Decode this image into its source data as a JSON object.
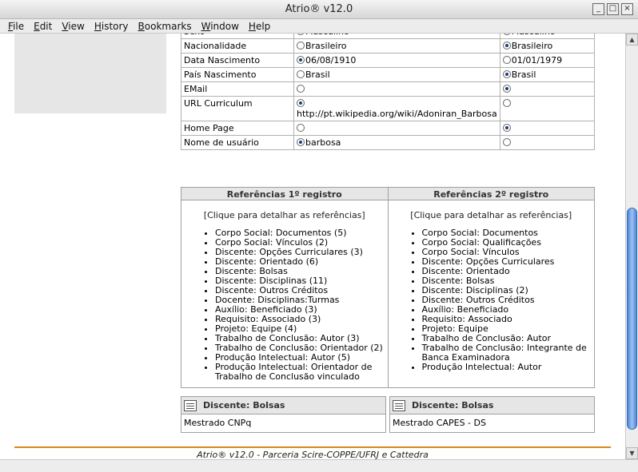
{
  "window": {
    "title": "Atrio® v12.0"
  },
  "menu": [
    "File",
    "Edit",
    "View",
    "History",
    "Bookmarks",
    "Window",
    "Help"
  ],
  "rows": [
    {
      "label": "Sexo",
      "v1": "Masculino",
      "v2": "Masculino",
      "sel": 0
    },
    {
      "label": "Nacionalidade",
      "v1": "Brasileiro",
      "v2": "Brasileiro",
      "sel": 2
    },
    {
      "label": "Data Nascimento",
      "v1": "06/08/1910",
      "v2": "01/01/1979",
      "sel": 1
    },
    {
      "label": "País Nascimento",
      "v1": "Brasil",
      "v2": "Brasil",
      "sel": 2
    },
    {
      "label": "EMail",
      "v1": "",
      "v2": "",
      "sel": 2
    },
    {
      "label": "URL Curriculum",
      "v1": "http://pt.wikipedia.org/wiki/Adoniran_Barbosa",
      "v2": "",
      "sel": 1
    },
    {
      "label": "Home Page",
      "v1": "",
      "v2": "",
      "sel": 2
    },
    {
      "label": "Nome de usuário",
      "v1": "barbosa",
      "v2": "",
      "sel": 1
    }
  ],
  "refs": {
    "first": {
      "title": "Referências 1º registro",
      "detail": "[Clique para detalhar as referências]",
      "items": [
        "Corpo Social: Documentos (5)",
        "Corpo Social: Vínculos (2)",
        "Discente: Opções Curriculares (3)",
        "Discente: Orientado (6)",
        "Discente: Bolsas",
        "Discente: Disciplinas (11)",
        "Discente: Outros Créditos",
        "Docente: Disciplinas:Turmas",
        "Auxílio: Beneficiado (3)",
        "Requisito: Associado (3)",
        "Projeto: Equipe (4)",
        "Trabalho de Conclusão: Autor (3)",
        "Trabalho de Conclusão: Orientador (2)",
        "Produção Intelectual: Autor (5)",
        "Produção Intelectual: Orientador de Trabalho de Conclusão vinculado"
      ]
    },
    "second": {
      "title": "Referências 2º registro",
      "detail": "[Clique para detalhar as referências]",
      "items": [
        "Corpo Social: Documentos",
        "Corpo Social: Qualificações",
        "Corpo Social: Vínculos",
        "Discente: Opções Curriculares",
        "Discente: Orientado",
        "Discente: Bolsas",
        "Discente: Disciplinas (2)",
        "Discente: Outros Créditos",
        "Auxílio: Beneficiado",
        "Requisito: Associado",
        "Projeto: Equipe",
        "Trabalho de Conclusão: Autor",
        "Trabalho de Conclusão: Integrante de Banca Examinadora",
        "Produção Intelectual: Autor"
      ]
    }
  },
  "panels": [
    {
      "title": "Discente: Bolsas",
      "value": "Mestrado CNPq"
    },
    {
      "title": "Discente: Bolsas",
      "value": "Mestrado CAPES - DS"
    }
  ],
  "footer": "Atrio® v12.0   -   Parceria Scire-COPPE/UFRJ e Cattedra"
}
